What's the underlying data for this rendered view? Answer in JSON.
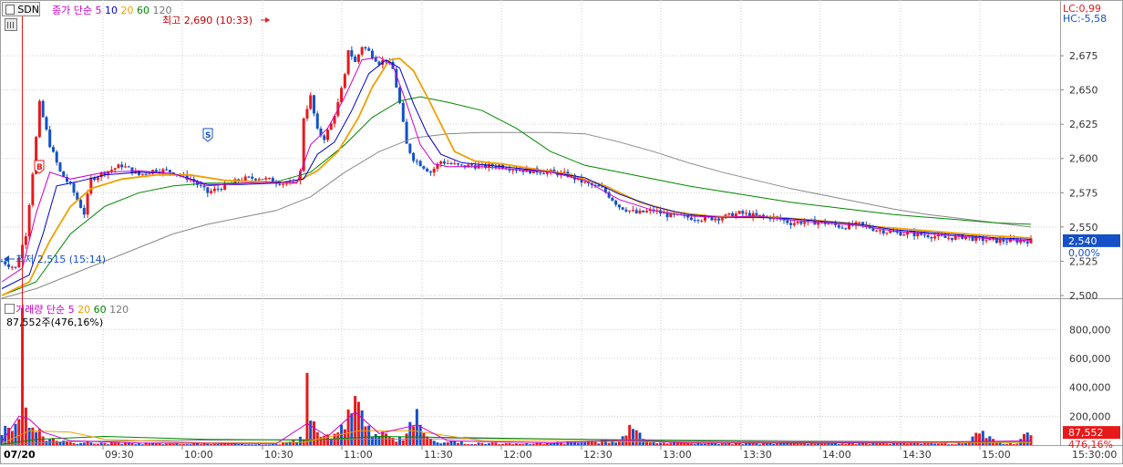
{
  "ticker": "SDN",
  "price_header": {
    "series_label": "종가",
    "ma_label": "단순",
    "ma_periods": [
      "5",
      "10",
      "20",
      "60",
      "120"
    ],
    "ma_colors": [
      "#cc00cc",
      "#0000cc",
      "#f0a000",
      "#008800",
      "#777777"
    ]
  },
  "volume_header": {
    "series_label": "거래량",
    "ma_label": "단순",
    "ma_periods": [
      "5",
      "20",
      "60",
      "120"
    ],
    "ma_colors": [
      "#cc00cc",
      "#f0a000",
      "#008800",
      "#777777"
    ],
    "current_value": "87,552주(476,16%)"
  },
  "annotations": {
    "high": "최고 2,690 (10:33)",
    "low": "최저 2,515 (15:14)",
    "buy_marker": "B",
    "sell_marker": "S"
  },
  "right_info": {
    "lc": "LC:0,99",
    "hc": "HC:-5,58"
  },
  "current_price": {
    "label": "2,540",
    "change": "0,00%"
  },
  "current_volume": {
    "label": "87,552",
    "ratio": "476,16%"
  },
  "colors": {
    "up": "#e8191a",
    "down": "#1450c8",
    "current_tag": "#e8191a",
    "current_tag_price": "#1450c8",
    "grid": "#cfcfcf"
  },
  "chart_data": {
    "type": "candlestick",
    "date_label": "07/20",
    "time_ticks": [
      "09:30",
      "10:00",
      "10:30",
      "11:00",
      "11:30",
      "12:00",
      "12:30",
      "13:00",
      "13:30",
      "14:00",
      "14:30",
      "15:00"
    ],
    "end_time_label": "15:30:00",
    "price_axis": {
      "min": 2490,
      "max": 2690,
      "ticks": [
        "2,500",
        "2,525",
        "2,550",
        "2,575",
        "2,600",
        "2,625",
        "2,650",
        "2,675"
      ]
    },
    "volume_axis": {
      "min": 0,
      "max": 960000,
      "ticks": [
        "200,000",
        "400,000",
        "600,000",
        "800,000"
      ]
    },
    "price_path": [
      [
        0,
        2525
      ],
      [
        4,
        2520
      ],
      [
        7,
        2545
      ],
      [
        9,
        2590
      ],
      [
        11,
        2640
      ],
      [
        14,
        2610
      ],
      [
        17,
        2590
      ],
      [
        20,
        2580
      ],
      [
        22,
        2570
      ],
      [
        24,
        2560
      ],
      [
        26,
        2585
      ],
      [
        30,
        2590
      ],
      [
        35,
        2595
      ],
      [
        40,
        2588
      ],
      [
        45,
        2592
      ],
      [
        50,
        2590
      ],
      [
        55,
        2585
      ],
      [
        60,
        2575
      ],
      [
        65,
        2580
      ],
      [
        70,
        2585
      ],
      [
        75,
        2586
      ],
      [
        80,
        2583
      ],
      [
        85,
        2581
      ],
      [
        87,
        2590
      ],
      [
        88,
        2630
      ],
      [
        90,
        2645
      ],
      [
        92,
        2620
      ],
      [
        94,
        2615
      ],
      [
        96,
        2625
      ],
      [
        98,
        2640
      ],
      [
        100,
        2660
      ],
      [
        101,
        2680
      ],
      [
        103,
        2670
      ],
      [
        105,
        2682
      ],
      [
        107,
        2678
      ],
      [
        110,
        2670
      ],
      [
        112,
        2672
      ],
      [
        114,
        2665
      ],
      [
        116,
        2640
      ],
      [
        117,
        2625
      ],
      [
        118,
        2610
      ],
      [
        120,
        2600
      ],
      [
        122,
        2596
      ],
      [
        125,
        2590
      ],
      [
        128,
        2598
      ],
      [
        131,
        2596
      ],
      [
        134,
        2594
      ],
      [
        137,
        2595
      ],
      [
        140,
        2594
      ],
      [
        145,
        2595
      ],
      [
        150,
        2592
      ],
      [
        155,
        2591
      ],
      [
        160,
        2590
      ],
      [
        165,
        2588
      ],
      [
        170,
        2582
      ],
      [
        175,
        2578
      ],
      [
        180,
        2565
      ],
      [
        185,
        2560
      ],
      [
        190,
        2562
      ],
      [
        195,
        2558
      ],
      [
        200,
        2557
      ],
      [
        205,
        2556
      ],
      [
        210,
        2557
      ],
      [
        215,
        2560
      ],
      [
        220,
        2558
      ],
      [
        225,
        2557
      ],
      [
        230,
        2553
      ],
      [
        235,
        2554
      ],
      [
        240,
        2553
      ],
      [
        245,
        2550
      ],
      [
        250,
        2552
      ],
      [
        255,
        2548
      ],
      [
        260,
        2546
      ],
      [
        265,
        2545
      ],
      [
        270,
        2544
      ],
      [
        275,
        2542
      ],
      [
        280,
        2543
      ],
      [
        285,
        2541
      ],
      [
        290,
        2540
      ],
      [
        295,
        2540
      ],
      [
        300,
        2540
      ]
    ],
    "ma5": [
      [
        0,
        2510
      ],
      [
        6,
        2520
      ],
      [
        10,
        2560
      ],
      [
        14,
        2590
      ],
      [
        20,
        2585
      ],
      [
        30,
        2590
      ],
      [
        40,
        2591
      ],
      [
        50,
        2589
      ],
      [
        60,
        2580
      ],
      [
        70,
        2582
      ],
      [
        80,
        2583
      ],
      [
        86,
        2582
      ],
      [
        90,
        2610
      ],
      [
        95,
        2622
      ],
      [
        100,
        2645
      ],
      [
        105,
        2672
      ],
      [
        110,
        2674
      ],
      [
        114,
        2668
      ],
      [
        118,
        2640
      ],
      [
        122,
        2610
      ],
      [
        126,
        2596
      ],
      [
        130,
        2594
      ],
      [
        140,
        2594
      ],
      [
        150,
        2592
      ],
      [
        160,
        2590
      ],
      [
        170,
        2584
      ],
      [
        180,
        2570
      ],
      [
        190,
        2562
      ],
      [
        200,
        2558
      ],
      [
        210,
        2557
      ],
      [
        220,
        2558
      ],
      [
        230,
        2555
      ],
      [
        240,
        2553
      ],
      [
        250,
        2551
      ],
      [
        260,
        2547
      ],
      [
        270,
        2545
      ],
      [
        280,
        2543
      ],
      [
        290,
        2541
      ],
      [
        300,
        2540
      ]
    ],
    "ma10": [
      [
        0,
        2505
      ],
      [
        8,
        2515
      ],
      [
        12,
        2545
      ],
      [
        16,
        2580
      ],
      [
        22,
        2583
      ],
      [
        30,
        2588
      ],
      [
        40,
        2590
      ],
      [
        50,
        2589
      ],
      [
        60,
        2581
      ],
      [
        70,
        2581
      ],
      [
        80,
        2582
      ],
      [
        88,
        2585
      ],
      [
        92,
        2603
      ],
      [
        97,
        2612
      ],
      [
        102,
        2635
      ],
      [
        107,
        2662
      ],
      [
        112,
        2672
      ],
      [
        116,
        2666
      ],
      [
        120,
        2640
      ],
      [
        124,
        2618
      ],
      [
        128,
        2603
      ],
      [
        134,
        2597
      ],
      [
        142,
        2595
      ],
      [
        150,
        2593
      ],
      [
        160,
        2590
      ],
      [
        170,
        2586
      ],
      [
        180,
        2574
      ],
      [
        190,
        2565
      ],
      [
        200,
        2559
      ],
      [
        210,
        2557
      ],
      [
        220,
        2557
      ],
      [
        230,
        2556
      ],
      [
        240,
        2554
      ],
      [
        250,
        2552
      ],
      [
        260,
        2548
      ],
      [
        270,
        2546
      ],
      [
        280,
        2544
      ],
      [
        290,
        2542
      ],
      [
        300,
        2541
      ]
    ],
    "ma20": [
      [
        0,
        2500
      ],
      [
        8,
        2510
      ],
      [
        14,
        2540
      ],
      [
        20,
        2565
      ],
      [
        26,
        2578
      ],
      [
        35,
        2585
      ],
      [
        45,
        2588
      ],
      [
        55,
        2588
      ],
      [
        65,
        2584
      ],
      [
        75,
        2583
      ],
      [
        85,
        2582
      ],
      [
        92,
        2591
      ],
      [
        98,
        2605
      ],
      [
        104,
        2630
      ],
      [
        108,
        2652
      ],
      [
        113,
        2672
      ],
      [
        116,
        2673
      ],
      [
        120,
        2664
      ],
      [
        124,
        2645
      ],
      [
        128,
        2625
      ],
      [
        132,
        2605
      ],
      [
        138,
        2598
      ],
      [
        146,
        2596
      ],
      [
        156,
        2592
      ],
      [
        166,
        2588
      ],
      [
        176,
        2580
      ],
      [
        186,
        2568
      ],
      [
        196,
        2561
      ],
      [
        206,
        2558
      ],
      [
        216,
        2557
      ],
      [
        226,
        2557
      ],
      [
        236,
        2555
      ],
      [
        246,
        2553
      ],
      [
        256,
        2550
      ],
      [
        266,
        2548
      ],
      [
        276,
        2546
      ],
      [
        286,
        2544
      ],
      [
        300,
        2542
      ]
    ],
    "ma60": [
      [
        0,
        2500
      ],
      [
        10,
        2510
      ],
      [
        20,
        2545
      ],
      [
        30,
        2565
      ],
      [
        40,
        2575
      ],
      [
        50,
        2580
      ],
      [
        60,
        2582
      ],
      [
        70,
        2582
      ],
      [
        80,
        2583
      ],
      [
        90,
        2590
      ],
      [
        100,
        2610
      ],
      [
        108,
        2630
      ],
      [
        116,
        2642
      ],
      [
        122,
        2645
      ],
      [
        130,
        2641
      ],
      [
        140,
        2635
      ],
      [
        150,
        2622
      ],
      [
        160,
        2605
      ],
      [
        170,
        2595
      ],
      [
        180,
        2590
      ],
      [
        190,
        2585
      ],
      [
        200,
        2580
      ],
      [
        210,
        2576
      ],
      [
        220,
        2572
      ],
      [
        230,
        2568
      ],
      [
        240,
        2565
      ],
      [
        250,
        2562
      ],
      [
        260,
        2559
      ],
      [
        270,
        2557
      ],
      [
        280,
        2555
      ],
      [
        290,
        2553
      ],
      [
        300,
        2552
      ]
    ],
    "ma120": [
      [
        0,
        2498
      ],
      [
        10,
        2505
      ],
      [
        20,
        2515
      ],
      [
        30,
        2525
      ],
      [
        40,
        2535
      ],
      [
        50,
        2545
      ],
      [
        60,
        2552
      ],
      [
        70,
        2557
      ],
      [
        80,
        2562
      ],
      [
        90,
        2572
      ],
      [
        100,
        2590
      ],
      [
        110,
        2605
      ],
      [
        120,
        2615
      ],
      [
        130,
        2618
      ],
      [
        140,
        2619
      ],
      [
        150,
        2619
      ],
      [
        160,
        2619
      ],
      [
        170,
        2618
      ],
      [
        180,
        2612
      ],
      [
        190,
        2605
      ],
      [
        200,
        2597
      ],
      [
        210,
        2590
      ],
      [
        220,
        2584
      ],
      [
        230,
        2578
      ],
      [
        240,
        2573
      ],
      [
        250,
        2568
      ],
      [
        260,
        2563
      ],
      [
        270,
        2559
      ],
      [
        280,
        2556
      ],
      [
        290,
        2553
      ],
      [
        300,
        2550
      ]
    ],
    "volume_spikes": [
      [
        2,
        120000
      ],
      [
        5,
        180000
      ],
      [
        6,
        950000
      ],
      [
        7,
        260000
      ],
      [
        8,
        120000
      ],
      [
        10,
        90000
      ],
      [
        12,
        60000
      ],
      [
        14,
        40000
      ],
      [
        16,
        30000
      ],
      [
        20,
        20000
      ],
      [
        30,
        15000
      ],
      [
        40,
        12000
      ],
      [
        50,
        10000
      ],
      [
        60,
        8000
      ],
      [
        70,
        8000
      ],
      [
        80,
        7000
      ],
      [
        88,
        40000
      ],
      [
        89,
        500000
      ],
      [
        90,
        170000
      ],
      [
        92,
        90000
      ],
      [
        96,
        40000
      ],
      [
        100,
        110000
      ],
      [
        102,
        220000
      ],
      [
        103,
        340000
      ],
      [
        104,
        300000
      ],
      [
        105,
        240000
      ],
      [
        106,
        130000
      ],
      [
        108,
        60000
      ],
      [
        110,
        60000
      ],
      [
        112,
        80000
      ],
      [
        114,
        50000
      ],
      [
        116,
        60000
      ],
      [
        118,
        80000
      ],
      [
        120,
        130000
      ],
      [
        121,
        250000
      ],
      [
        122,
        140000
      ],
      [
        124,
        60000
      ],
      [
        126,
        30000
      ],
      [
        130,
        20000
      ],
      [
        140,
        15000
      ],
      [
        150,
        12000
      ],
      [
        160,
        15000
      ],
      [
        170,
        20000
      ],
      [
        180,
        25000
      ],
      [
        183,
        140000
      ],
      [
        190,
        20000
      ],
      [
        200,
        15000
      ],
      [
        210,
        12000
      ],
      [
        220,
        12000
      ],
      [
        230,
        15000
      ],
      [
        240,
        12000
      ],
      [
        250,
        12000
      ],
      [
        260,
        20000
      ],
      [
        270,
        15000
      ],
      [
        280,
        12000
      ],
      [
        285,
        80000
      ],
      [
        290,
        15000
      ],
      [
        296,
        10000
      ],
      [
        299,
        87552
      ]
    ],
    "volume_ma5": [
      [
        0,
        20000
      ],
      [
        5,
        200000
      ],
      [
        8,
        180000
      ],
      [
        12,
        90000
      ],
      [
        20,
        30000
      ],
      [
        40,
        15000
      ],
      [
        80,
        10000
      ],
      [
        89,
        150000
      ],
      [
        95,
        60000
      ],
      [
        103,
        230000
      ],
      [
        110,
        80000
      ],
      [
        121,
        140000
      ],
      [
        130,
        30000
      ],
      [
        160,
        15000
      ],
      [
        183,
        35000
      ],
      [
        200,
        15000
      ],
      [
        240,
        14000
      ],
      [
        285,
        25000
      ],
      [
        300,
        30000
      ]
    ],
    "volume_ma20": [
      [
        0,
        10000
      ],
      [
        8,
        100000
      ],
      [
        20,
        90000
      ],
      [
        30,
        40000
      ],
      [
        60,
        15000
      ],
      [
        88,
        20000
      ],
      [
        104,
        100000
      ],
      [
        120,
        100000
      ],
      [
        140,
        30000
      ],
      [
        180,
        25000
      ],
      [
        240,
        15000
      ],
      [
        300,
        18000
      ]
    ],
    "volume_ma60": [
      [
        0,
        5000
      ],
      [
        10,
        40000
      ],
      [
        30,
        60000
      ],
      [
        60,
        40000
      ],
      [
        90,
        35000
      ],
      [
        110,
        60000
      ],
      [
        140,
        50000
      ],
      [
        180,
        35000
      ],
      [
        240,
        20000
      ],
      [
        300,
        18000
      ]
    ],
    "volume_ma120": [
      [
        0,
        3000
      ],
      [
        20,
        25000
      ],
      [
        60,
        35000
      ],
      [
        100,
        40000
      ],
      [
        140,
        45000
      ],
      [
        200,
        35000
      ],
      [
        260,
        25000
      ],
      [
        300,
        20000
      ]
    ]
  }
}
